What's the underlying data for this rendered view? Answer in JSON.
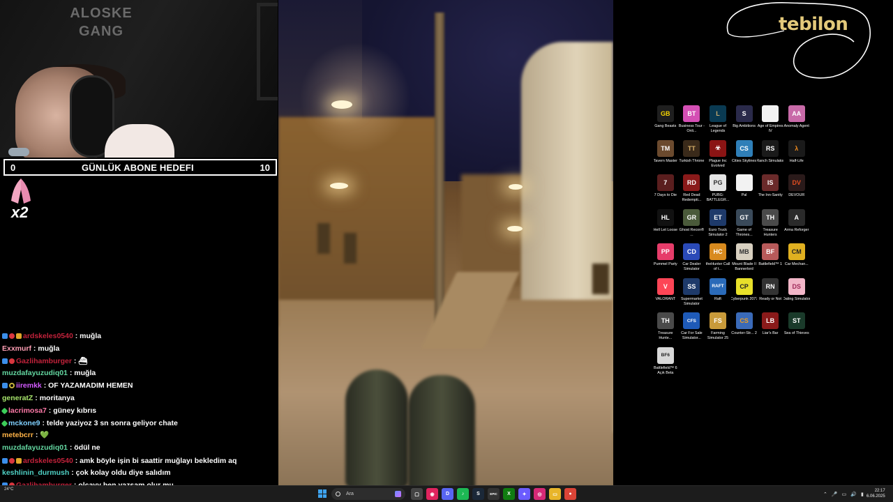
{
  "webcam": {
    "poster_text": "ALOSKE\nGANG"
  },
  "sub_goal": {
    "current": "0",
    "title": "GÜNLÜK ABONE HEDEFI",
    "target": "10"
  },
  "alert": {
    "multiplier": "x2"
  },
  "chat": [
    {
      "user": "ardskeles0540",
      "color": "#c2223b",
      "badges": [
        "b-blue",
        "b-red",
        "b-gold"
      ],
      "message": "muğla"
    },
    {
      "user": "Exxmurf",
      "color": "#ff9fb5",
      "badges": [],
      "message": "muğla"
    },
    {
      "user": "Gazlihamburger",
      "color": "#c2223b",
      "badges": [
        "b-blue",
        "b-red"
      ],
      "message": "⛴"
    },
    {
      "user": "muzdafayuzudiq01",
      "color": "#63d6a0",
      "badges": [],
      "message": "muğla"
    },
    {
      "user": "iiremkk",
      "color": "#d25bff",
      "badges": [
        "b-blue",
        "b-ring"
      ],
      "message": "OF YAZAMADIM HEMEN"
    },
    {
      "user": "generatZ",
      "color": "#a6e36b",
      "badges": [],
      "message": "moritanya"
    },
    {
      "user": "lacrimosa7",
      "color": "#ff7aa8",
      "badges": [
        "b-green"
      ],
      "message": "güney kıbrıs"
    },
    {
      "user": "mckone9",
      "color": "#7fd0ff",
      "badges": [
        "b-green"
      ],
      "message": "telde yaziyoz 3 sn sonra geliyor chate"
    },
    {
      "user": "metebcrr",
      "color": "#ffb347",
      "badges": [],
      "message": "💚"
    },
    {
      "user": "muzdafayuzudiq01",
      "color": "#63d6a0",
      "badges": [],
      "message": "ödül ne"
    },
    {
      "user": "ardskeles0540",
      "color": "#c2223b",
      "badges": [
        "b-blue",
        "b-red",
        "b-gold"
      ],
      "message": "amk böyle işin bi saattir muğlayı bekledim aq",
      "wrap": true
    },
    {
      "user": "keshlinin_durmush",
      "color": "#4fd1c5",
      "badges": [],
      "message": "çok kolay oldu diye salıdım"
    },
    {
      "user": "Gazlihamburger",
      "color": "#c2223b",
      "badges": [
        "b-blue",
        "b-red"
      ],
      "message": "olcayy ben yazsam olur mu"
    }
  ],
  "brand": {
    "name": "tebilon",
    "accent": "#e3c97a"
  },
  "desktop_icons": [
    {
      "label": "Gang Beasts",
      "bg": "#1f1f1f",
      "glyph": "GB",
      "fg": "#f5d400"
    },
    {
      "label": "Business Tour - Onli...",
      "bg": "#d44fb4",
      "glyph": "BT",
      "fg": "#fff"
    },
    {
      "label": "League of Legends",
      "bg": "#0a3a52",
      "glyph": "L",
      "fg": "#c8aa6e"
    },
    {
      "label": "Big Ambitions",
      "bg": "#2a2a4a",
      "glyph": "S",
      "fg": "#fff"
    },
    {
      "label": "Age of Empires IV",
      "bg": "#f2f2f2",
      "glyph": "",
      "fg": "#000"
    },
    {
      "label": "Anomaly Agent",
      "bg": "#c86aa8",
      "glyph": "AA",
      "fg": "#fff"
    },
    {
      "label": "Tavern Master",
      "bg": "#6b4a2e",
      "glyph": "TM",
      "fg": "#fff"
    },
    {
      "label": "Turkish Throne",
      "bg": "#3a2a1a",
      "glyph": "TT",
      "fg": "#d8b06a"
    },
    {
      "label": "Plague Inc Evolved",
      "bg": "#8a1414",
      "glyph": "☣",
      "fg": "#fff"
    },
    {
      "label": "Cities Skylines",
      "bg": "#2f7fb8",
      "glyph": "CS",
      "fg": "#fff"
    },
    {
      "label": "Ranch Simulator",
      "bg": "#1a1a1a",
      "glyph": "RS",
      "fg": "#fff"
    },
    {
      "label": "Half-Life",
      "bg": "#1a1a1a",
      "glyph": "λ",
      "fg": "#f28c1e"
    },
    {
      "label": "7 Days to Die",
      "bg": "#5a1e1e",
      "glyph": "7",
      "fg": "#fff"
    },
    {
      "label": "Red Dead Redempti...",
      "bg": "#8a1a1a",
      "glyph": "RD",
      "fg": "#fff"
    },
    {
      "label": "PUBG: BATTLEGR...",
      "bg": "#e5e5e5",
      "glyph": "PG",
      "fg": "#333"
    },
    {
      "label": "Pal",
      "bg": "#f2f2f2",
      "glyph": "",
      "fg": "#000"
    },
    {
      "label": "The Inn-Sanity",
      "bg": "#6a2a2a",
      "glyph": "IS",
      "fg": "#fff"
    },
    {
      "label": "DEVOUR",
      "bg": "#2a1a1a",
      "glyph": "DV",
      "fg": "#e24d20"
    },
    {
      "label": "Hell Let Loose",
      "bg": "#111",
      "glyph": "HL",
      "fg": "#fff"
    },
    {
      "label": "Ghost Recon® ...",
      "bg": "#4a5a3a",
      "glyph": "GR",
      "fg": "#fff"
    },
    {
      "label": "Euro Truck Simulator 2",
      "bg": "#1e3a6a",
      "glyph": "ET",
      "fg": "#fff"
    },
    {
      "label": "Game of Thrones...",
      "bg": "#3a4a5a",
      "glyph": "GT",
      "fg": "#fff"
    },
    {
      "label": "Treasure Hunters",
      "bg": "#4a4a4a",
      "glyph": "TH",
      "fg": "#fff"
    },
    {
      "label": "Arma Reforger",
      "bg": "#2a2a2a",
      "glyph": "A",
      "fg": "#fff"
    },
    {
      "label": "Pummel Party",
      "bg": "#e63c6a",
      "glyph": "PP",
      "fg": "#fff"
    },
    {
      "label": "Car Dealer Simulator",
      "bg": "#2a4ab8",
      "glyph": "CD",
      "fg": "#fff"
    },
    {
      "label": "theHunter Call of t...",
      "bg": "#d88a1e",
      "glyph": "HC",
      "fg": "#fff"
    },
    {
      "label": "Mount Blade II Bannerlord",
      "bg": "#d8d0c0",
      "glyph": "MB",
      "fg": "#333"
    },
    {
      "label": "Battlefield™ 1",
      "bg": "#b85a5a",
      "glyph": "BF",
      "fg": "#fff"
    },
    {
      "label": "Car Mechan...",
      "bg": "#e0b020",
      "glyph": "CM",
      "fg": "#222"
    },
    {
      "label": "VALORANT",
      "bg": "#fd4556",
      "glyph": "V",
      "fg": "#fff"
    },
    {
      "label": "Supermarket Simulator",
      "bg": "#1e3a6a",
      "glyph": "SS",
      "fg": "#fff"
    },
    {
      "label": "Raft",
      "bg": "#2a6ab8",
      "glyph": "RAFT",
      "fg": "#fff"
    },
    {
      "label": "Cyberpunk 2077",
      "bg": "#e8e02a",
      "glyph": "CP",
      "fg": "#222"
    },
    {
      "label": "Ready or Not",
      "bg": "#333",
      "glyph": "RN",
      "fg": "#fff"
    },
    {
      "label": "Dating Simulator",
      "bg": "#f2b6c8",
      "glyph": "DS",
      "fg": "#a02a5a"
    },
    {
      "label": "Treasure Hunte...",
      "bg": "#4a4a4a",
      "glyph": "TH",
      "fg": "#fff"
    },
    {
      "label": "Car For Sale Simulator...",
      "bg": "#1e5ab8",
      "glyph": "CFS",
      "fg": "#fff"
    },
    {
      "label": "Farming Simulator 25",
      "bg": "#c89a3a",
      "glyph": "FS",
      "fg": "#fff"
    },
    {
      "label": "Counter-Str... 2",
      "bg": "#3a6ab8",
      "glyph": "CS",
      "fg": "#f2a020"
    },
    {
      "label": "Liar's Bar",
      "bg": "#8a1a1a",
      "glyph": "LB",
      "fg": "#fff"
    },
    {
      "label": "Sea of Thieves",
      "bg": "#1a3a2a",
      "glyph": "ST",
      "fg": "#fff"
    },
    {
      "label": "Battlefield™ 6 Açık Beta",
      "bg": "#d8d8d8",
      "glyph": "BF6",
      "fg": "#222"
    }
  ],
  "taskbar": {
    "weather_temp": "24°C",
    "search_placeholder": "Ara",
    "apps": [
      {
        "name": "task-view",
        "bg": "#444",
        "glyph": "▢"
      },
      {
        "name": "edge-app",
        "bg": "#e0245e",
        "glyph": "◉"
      },
      {
        "name": "discord-app",
        "bg": "#5865f2",
        "glyph": "D"
      },
      {
        "name": "spotify-app",
        "bg": "#1db954",
        "glyph": "♪"
      },
      {
        "name": "steam-app",
        "bg": "#1b2838",
        "glyph": "S"
      },
      {
        "name": "epic-app",
        "bg": "#333",
        "glyph": "EPIC"
      },
      {
        "name": "xbox-app",
        "bg": "#107c10",
        "glyph": "X"
      },
      {
        "name": "copilot-app",
        "bg": "#6b5cff",
        "glyph": "✦"
      },
      {
        "name": "instagram-app",
        "bg": "#d62976",
        "glyph": "◎"
      },
      {
        "name": "explorer-app",
        "bg": "#e8b52a",
        "glyph": "▭"
      },
      {
        "name": "chrome-app",
        "bg": "#db4437",
        "glyph": "●"
      }
    ],
    "time": "22:17",
    "date": "6.06.2025"
  }
}
